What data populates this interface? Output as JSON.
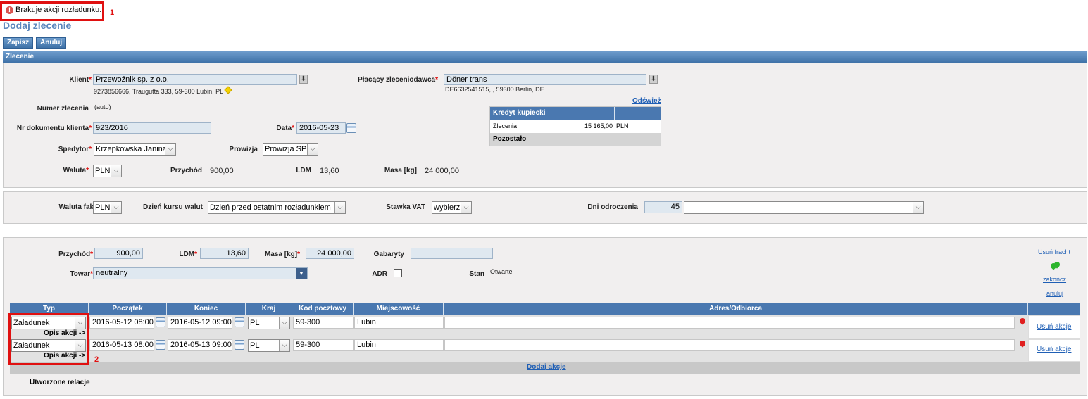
{
  "alert": {
    "message": "Brakuje akcji rozładunku.",
    "icon": "error-icon"
  },
  "page_title": "Dodaj zlecenie",
  "toolbar": {
    "save_label": "Zapisz",
    "cancel_label": "Anuluj"
  },
  "order": {
    "section_title": "Zlecenie",
    "client": {
      "label": "Klient",
      "value": "Przewoźnik sp. z o.o.",
      "address": "9273856666, Traugutta 333, 59-300 Lubin, PL"
    },
    "payer": {
      "label": "Płacący zleceniodawca",
      "value": "Döner trans",
      "address": "DE6632541515, , 59300 Berlin, DE"
    },
    "refresh_link": "Odśwież",
    "credit": {
      "title": "Kredyt kupiecki",
      "row1_label": "Zlecenia",
      "row1_amount": "15 165,00",
      "row1_currency": "PLN",
      "row2_label": "Pozostało"
    },
    "order_number": {
      "label": "Numer zlecenia",
      "value": "(auto)"
    },
    "client_doc": {
      "label": "Nr dokumentu klienta",
      "value": "923/2016"
    },
    "date": {
      "label": "Data",
      "value": "2016-05-23"
    },
    "forwarder": {
      "label": "Spedytor",
      "value": "Krzepkowska Janina"
    },
    "commission": {
      "label": "Prowizja",
      "value": "Prowizja SP"
    },
    "currency": {
      "label": "Waluta",
      "value": "PLN"
    },
    "income": {
      "label": "Przychód",
      "value": "900,00"
    },
    "ldm": {
      "label": "LDM",
      "value": "13,60"
    },
    "mass": {
      "label": "Masa [kg]",
      "value": "24 000,00"
    }
  },
  "invoice": {
    "currency": {
      "label": "Waluta faktury",
      "value": "PLN"
    },
    "rate_day": {
      "label": "Dzień kursu walut",
      "value": "Dzień przed ostatnim rozładunkiem"
    },
    "vat": {
      "label": "Stawka VAT",
      "value": "wybierz"
    },
    "deferral": {
      "label": "Dni odroczenia",
      "value": "45"
    }
  },
  "freight": {
    "income": {
      "label": "Przychód",
      "value": "900,00"
    },
    "ldm": {
      "label": "LDM",
      "value": "13,60"
    },
    "mass": {
      "label": "Masa [kg]",
      "value": "24 000,00"
    },
    "dimensions": {
      "label": "Gabaryty",
      "value": ""
    },
    "goods": {
      "label": "Towar",
      "value": "neutralny"
    },
    "adr": {
      "label": "ADR"
    },
    "status": {
      "label": "Stan",
      "value": "Otwarte"
    },
    "remove_freight": "Usuń fracht",
    "finish": "zakończ",
    "cancel": "anuluj",
    "columns": [
      "Typ",
      "Początek",
      "Koniec",
      "Kraj",
      "Kod pocztowy",
      "Miejscowość",
      "Adres/Odbiorca"
    ],
    "rows": [
      {
        "type": "Załadunek",
        "start": "2016-05-12 08:00",
        "end": "2016-05-12 09:00",
        "country": "PL",
        "postal": "59-300",
        "city": "Lubin",
        "address": "",
        "desc": "Opis akcji ->",
        "remove": "Usuń akcje"
      },
      {
        "type": "Załadunek",
        "start": "2016-05-13 08:00",
        "end": "2016-05-13 09:00",
        "country": "PL",
        "postal": "59-300",
        "city": "Lubin",
        "address": "",
        "desc": "Opis akcji ->",
        "remove": "Usuń akcje"
      }
    ],
    "add_action": "Dodaj akcje",
    "relations": "Utworzone relacje"
  },
  "annotations": {
    "n1": "1",
    "n2": "2"
  },
  "colors": {
    "accent": "#4a78b0",
    "error": "#e01010",
    "link": "#1f5fb5"
  }
}
